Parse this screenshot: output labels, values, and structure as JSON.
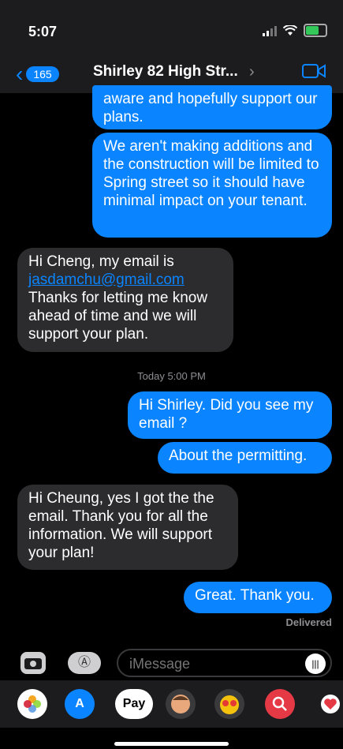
{
  "status_bar": {
    "time": "5:07"
  },
  "header": {
    "back_count": "165",
    "contact_name": "Shirley 82 High Str...",
    "chevron": "›"
  },
  "messages": [
    {
      "side": "out",
      "text": "aware and hopefully support our plans."
    },
    {
      "side": "out",
      "text": "We aren't making additions and the construction will be limited to Spring street so it should have minimal impact on your tenant."
    },
    {
      "side": "in",
      "text_before": "Hi Cheng, my email is",
      "link": "jasdamchu@gmail.com",
      "text_after": "Thanks for letting me know ahead of time and we will support your plan."
    },
    {
      "side": "out",
      "text": "Hi Shirley. Did you see my email ?"
    },
    {
      "side": "out",
      "text": "About the permitting."
    },
    {
      "side": "in",
      "text": "Hi Cheung, yes I got the the email. Thank you for all the information. We will support your plan!"
    },
    {
      "side": "out",
      "text": "Great. Thank you."
    }
  ],
  "timestamp": "Today 5:00 PM",
  "delivered": "Delivered",
  "composer": {
    "placeholder": "iMessage"
  },
  "app_tray": [
    "photos-icon",
    "app-store-icon",
    "apple-pay-icon",
    "memoji-icon",
    "animoji-icon",
    "search-images-icon",
    "digital-touch-icon"
  ],
  "apple_pay_label": "Pay",
  "colors": {
    "accent": "#0a84ff",
    "incoming": "#2c2c2e",
    "battery": "#34c759"
  }
}
